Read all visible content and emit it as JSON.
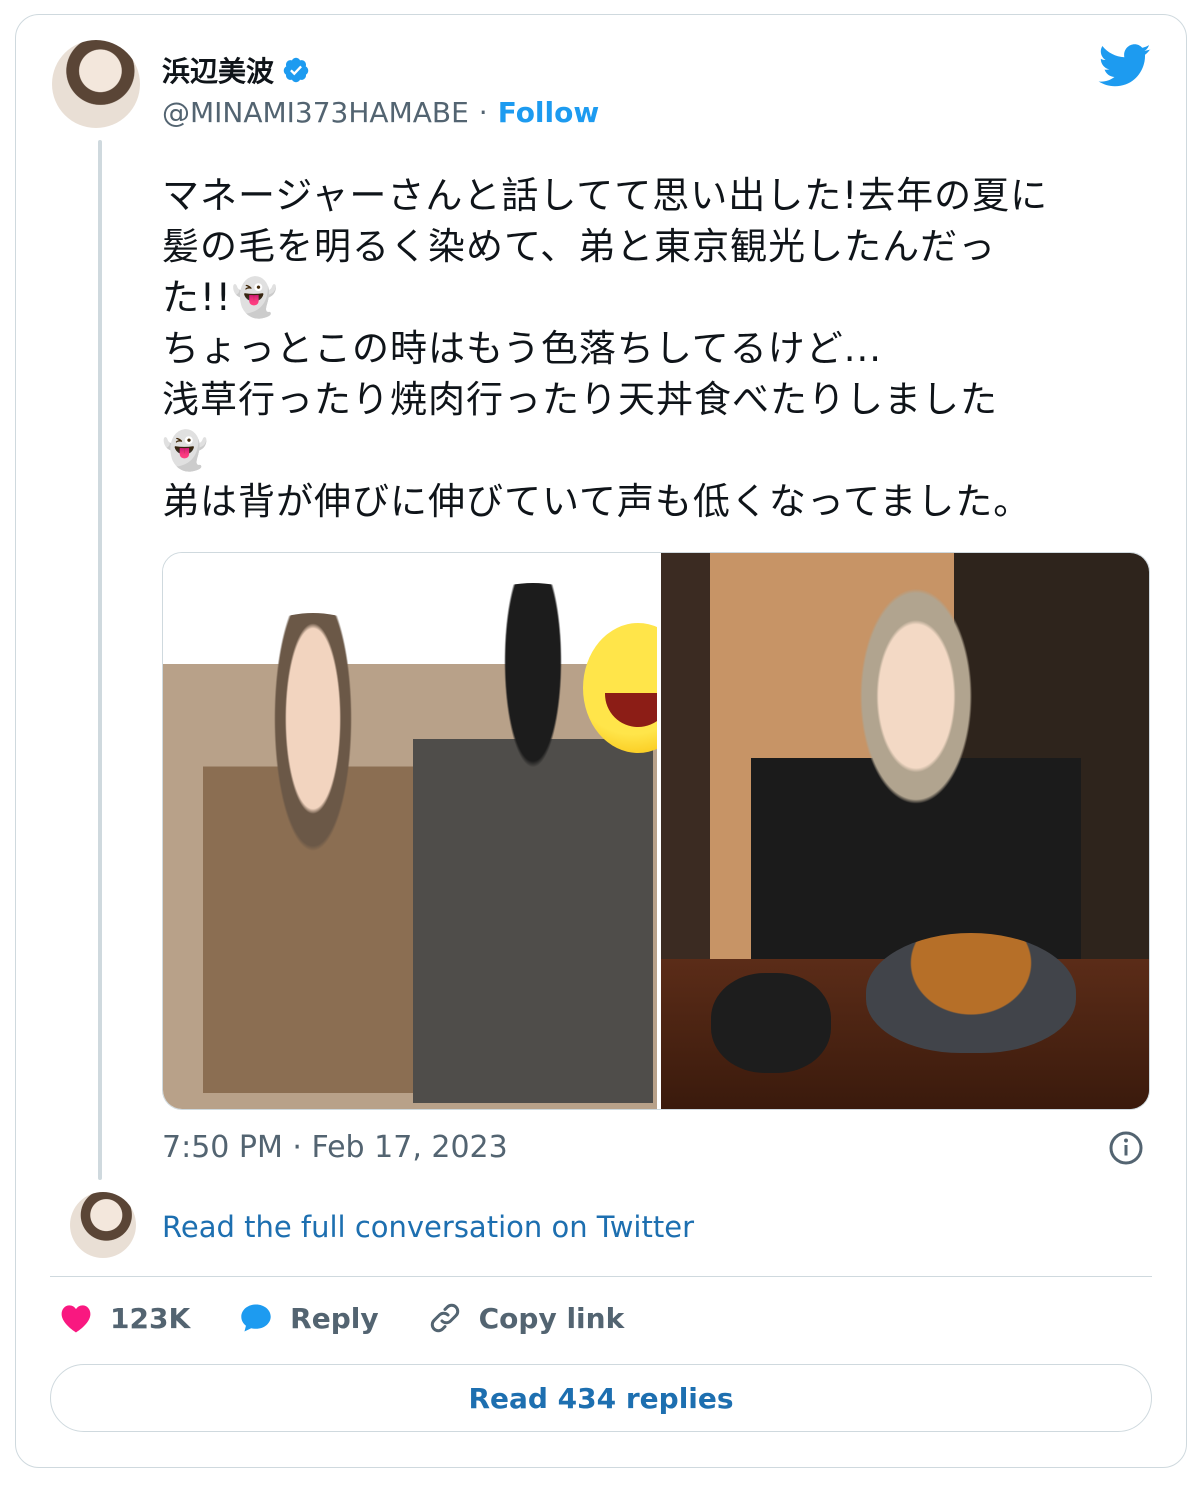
{
  "author": {
    "display_name": "浜辺美波",
    "handle": "@MINAMI373HAMABE",
    "separator": "·",
    "follow_label": "Follow"
  },
  "tweet": {
    "text": "マネージャーさんと話してて思い出した!去年の夏に\n髪の毛を明るく染めて、弟と東京観光したんだっ\nた!!👻\nちょっとこの時はもう色落ちしてるけど...\n浅草行ったり焼肉行ったり天丼食べたりしました\n👻\n弟は背が伸びに伸びていて声も低くなってました。",
    "timestamp": "7:50 PM · Feb 17, 2023"
  },
  "conversation_link": "Read the full conversation on Twitter",
  "actions": {
    "like_count": "123K",
    "reply_label": "Reply",
    "copy_label": "Copy link"
  },
  "read_replies_label": "Read 434 replies",
  "colors": {
    "twitter_blue": "#1d9bf0",
    "link_blue": "#1d6fb0",
    "heart_pink": "#f91880",
    "muted_gray": "#536471",
    "border": "#cfd9de"
  },
  "icons": {
    "brand": "twitter-bird-icon",
    "verified": "verified-badge-icon",
    "info": "info-icon",
    "like": "heart-icon",
    "reply": "speech-bubble-icon",
    "copy": "link-icon"
  }
}
